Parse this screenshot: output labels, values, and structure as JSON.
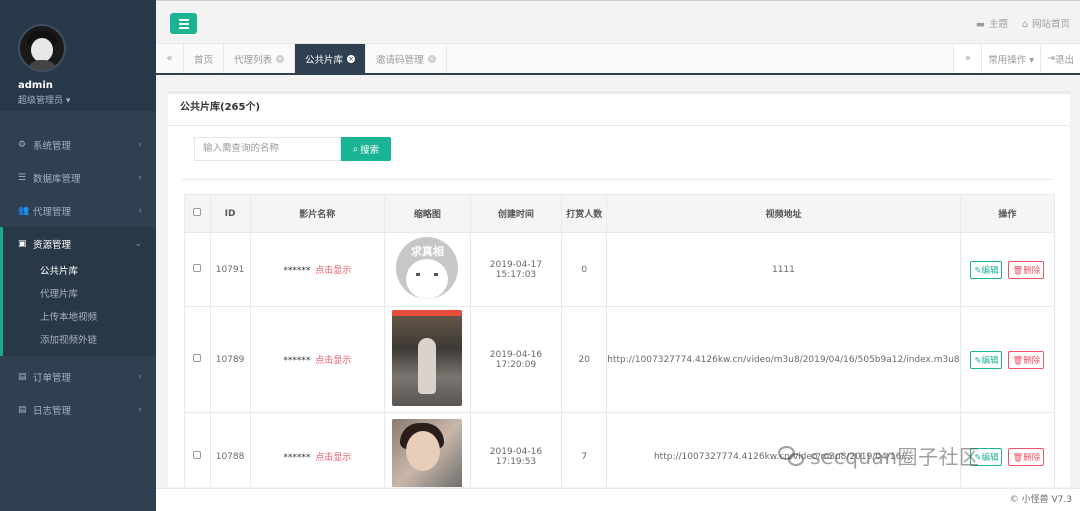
{
  "profile": {
    "name": "admin",
    "role": "超级管理员 ▾"
  },
  "menu": {
    "items": [
      {
        "icon": "⚙",
        "label": "系统管理",
        "arrow": "‹"
      },
      {
        "icon": "☰",
        "label": "数据库管理",
        "arrow": "‹"
      },
      {
        "icon": "👥",
        "label": "代理管理",
        "arrow": "‹"
      },
      {
        "icon": "▣",
        "label": "资源管理",
        "arrow": "⌄"
      },
      {
        "icon": "▤",
        "label": "订单管理",
        "arrow": "‹"
      },
      {
        "icon": "▤",
        "label": "日志管理",
        "arrow": "‹"
      }
    ],
    "sub": [
      "公共片库",
      "代理片库",
      "上传本地视频",
      "添加视频外链"
    ]
  },
  "topbar": {
    "theme_label": "主题",
    "home_label": "网站首页"
  },
  "tabs": {
    "items": [
      "首页",
      "代理列表",
      "公共片库",
      "邀请码管理"
    ],
    "common_ops": "常用操作 ▾",
    "exit": "退出"
  },
  "panel": {
    "title": "公共片库(265个)",
    "search_placeholder": "输入需查询的名称",
    "search_button": "搜索"
  },
  "table": {
    "headers": [
      "ID",
      "影片名称",
      "缩略图",
      "创建时间",
      "打赏人数",
      "视频地址",
      "操作"
    ],
    "rows": [
      {
        "id": "10791",
        "name_mask": "******",
        "reveal": "点击显示",
        "thumb_caption": "求真相",
        "time_date": "2019-04-17",
        "time_clock": "15:17:03",
        "tips": "0",
        "url": "1111"
      },
      {
        "id": "10789",
        "name_mask": "******",
        "reveal": "点击显示",
        "thumb_caption": "",
        "time_date": "2019-04-16",
        "time_clock": "17:20:09",
        "tips": "20",
        "url": "http://1007327774.4126kw.cn/video/m3u8/2019/04/16/505b9a12/index.m3u8"
      },
      {
        "id": "10788",
        "name_mask": "******",
        "reveal": "点击显示",
        "thumb_caption": "",
        "time_date": "2019-04-16",
        "time_clock": "17:19:53",
        "tips": "7",
        "url": "http://1007327774.4126kw.cn/video/m3u8/2019/04/16/..."
      }
    ],
    "edit_label": "编辑",
    "delete_label": "删除"
  },
  "footer": {
    "text": "© 小怪兽 V7.3"
  },
  "watermark": {
    "text": "secquan圈子社区"
  },
  "colors": {
    "sidebar": "#2f4050",
    "accent": "#1ab394",
    "danger": "#ed5565"
  }
}
